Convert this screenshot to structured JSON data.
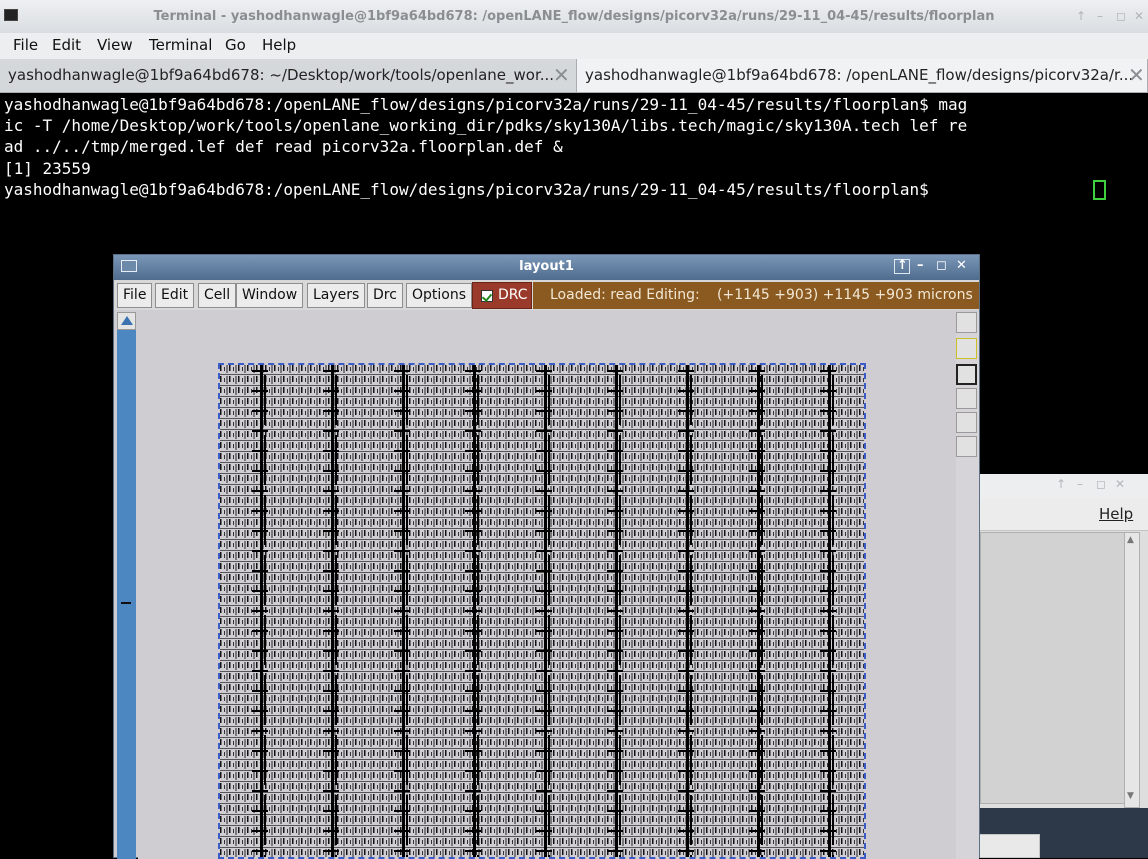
{
  "terminal": {
    "title": "Terminal - yashodhanwagle@1bf9a64bd678: /openLANE_flow/designs/picorv32a/runs/29-11_04-45/results/floorplan",
    "controls": [
      "↑",
      "–",
      "◻",
      "✕"
    ],
    "menu": [
      "File",
      "Edit",
      "View",
      "Terminal",
      "Go",
      "Help"
    ],
    "tabs": [
      {
        "label": "yashodhanwagle@1bf9a64bd678: ~/Desktop/work/tools/openlane_wor...",
        "close": "✕"
      },
      {
        "label": "yashodhanwagle@1bf9a64bd678: /openLANE_flow/designs/picorv32a/r...",
        "close": "✕"
      }
    ],
    "lines": [
      "yashodhanwagle@1bf9a64bd678:/openLANE_flow/designs/picorv32a/runs/29-11_04-45/results/floorplan$ mag",
      "ic -T /home/Desktop/work/tools/openlane_working_dir/pdks/sky130A/libs.tech/magic/sky130A.tech lef re",
      "ad ../../tmp/merged.lef def read picorv32a.floorplan.def &",
      "[1] 23559",
      "yashodhanwagle@1bf9a64bd678:/openLANE_flow/designs/picorv32a/runs/29-11_04-45/results/floorplan$ "
    ],
    "cursor_color": "#3fd03f"
  },
  "background_window": {
    "controls": [
      "↑",
      "–",
      "◻",
      "✕"
    ],
    "help_label": "Help",
    "scroll_up": "▲",
    "scroll_down": "▼"
  },
  "magic": {
    "title": "layout1",
    "title_buttons": [
      "↑",
      "–",
      "◻",
      "✕"
    ],
    "menu": [
      "File",
      "Edit",
      "Cell",
      "Window",
      "Layers",
      "Drc",
      "Options"
    ],
    "drc": {
      "label": "DRC",
      "checked": true
    },
    "status": {
      "loaded": "Loaded: read Editing:",
      "coords": "(+1145 +903) +1145 +903 microns"
    },
    "colors": {
      "die_border": "#3a5cc8",
      "status_bg": "#8b5a20",
      "drc_bg": "#9a3a2a",
      "titlebar": "#5f7fa3"
    }
  }
}
